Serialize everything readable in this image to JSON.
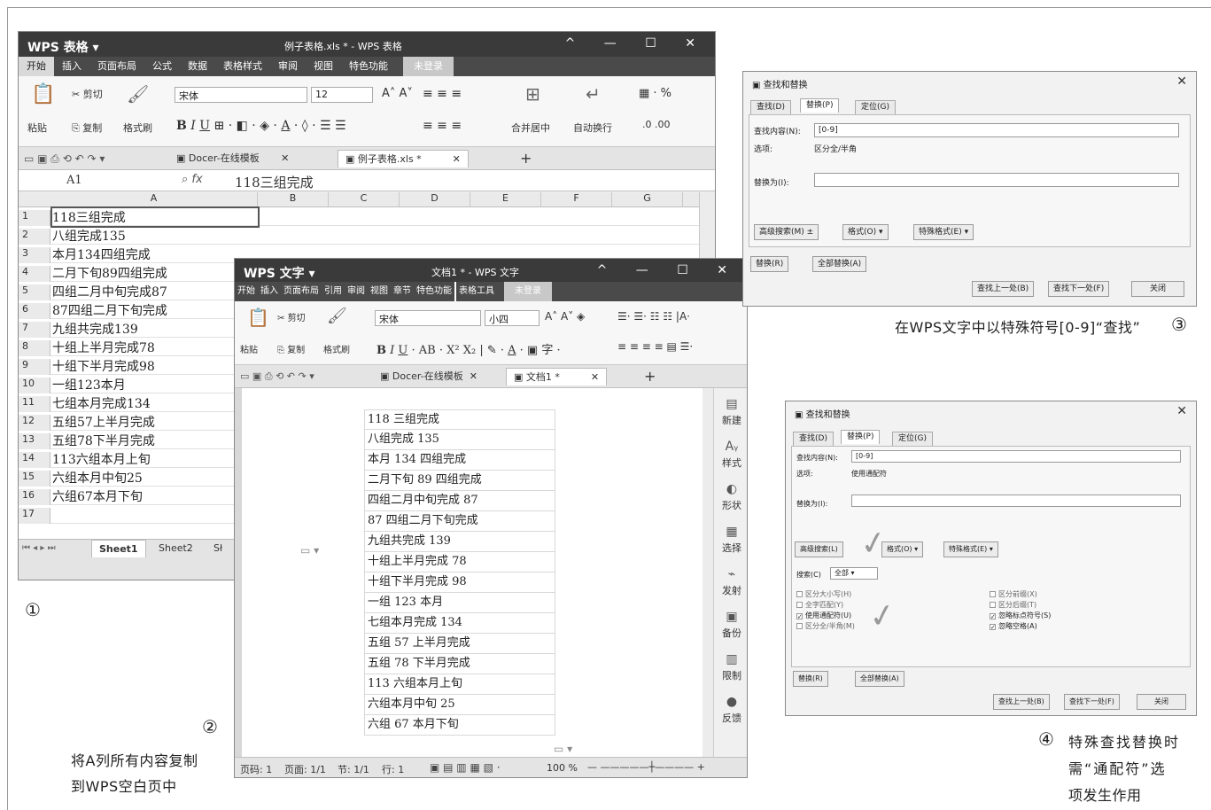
{
  "excel": {
    "app_name": "WPS 表格",
    "doc_title": "例子表格.xls * - WPS 表格",
    "menu": [
      "开始",
      "插入",
      "页面布局",
      "公式",
      "数据",
      "表格样式",
      "审阅",
      "视图",
      "特色功能"
    ],
    "login": "未登录",
    "ribbon": {
      "paste": "粘贴",
      "cut": "剪切",
      "copy": "复制",
      "format_painter": "格式刷",
      "font": "宋体",
      "font_size": "12",
      "merge_center": "合并居中",
      "wrap": "自动换行"
    },
    "tabs": [
      "Docer-在线模板",
      "例子表格.xls *"
    ],
    "cell_ref": "A1",
    "formula": "118三组完成",
    "columns": [
      "A",
      "B",
      "C",
      "D",
      "E",
      "F",
      "G"
    ],
    "rows": [
      {
        "n": "1",
        "v": "118三组完成"
      },
      {
        "n": "2",
        "v": "八组完成135"
      },
      {
        "n": "3",
        "v": "本月134四组完成"
      },
      {
        "n": "4",
        "v": "二月下旬89四组完成"
      },
      {
        "n": "5",
        "v": "四组二月中旬完成87"
      },
      {
        "n": "6",
        "v": "87四组二月下旬完成"
      },
      {
        "n": "7",
        "v": "九组共完成139"
      },
      {
        "n": "8",
        "v": "十组上半月完成78"
      },
      {
        "n": "9",
        "v": "十组下半月完成98"
      },
      {
        "n": "10",
        "v": "一组123本月"
      },
      {
        "n": "11",
        "v": "七组本月完成134"
      },
      {
        "n": "12",
        "v": "五组57上半月完成"
      },
      {
        "n": "13",
        "v": "五组78下半月完成"
      },
      {
        "n": "14",
        "v": "113六组本月上旬"
      },
      {
        "n": "15",
        "v": "六组本月中旬25"
      },
      {
        "n": "16",
        "v": "六组67本月下旬"
      },
      {
        "n": "17",
        "v": ""
      }
    ],
    "sheets": [
      "Sheet1",
      "Sheet2",
      "Sł"
    ]
  },
  "writer": {
    "app_name": "WPS 文字",
    "doc_title": "文档1 * - WPS 文字",
    "menu": [
      "开始",
      "插入",
      "页面布局",
      "引用",
      "审阅",
      "视图",
      "章节",
      "特色功能",
      "表格工具"
    ],
    "login": "未登录",
    "ribbon": {
      "paste": "粘贴",
      "cut": "剪切",
      "copy": "复制",
      "format_painter": "格式刷",
      "font": "宋体",
      "font_size": "小四"
    },
    "tabs": [
      "Docer-在线模板",
      "文档1 *"
    ],
    "lines": [
      "118 三组完成",
      "八组完成 135",
      "本月 134 四组完成",
      "二月下旬 89 四组完成",
      "四组二月中旬完成 87",
      "87 四组二月下旬完成",
      "九组共完成 139",
      "十组上半月完成 78",
      "十组下半月完成 98",
      "一组 123 本月",
      "七组本月完成 134",
      "五组 57 上半月完成",
      "五组 78 下半月完成",
      "113 六组本月上旬",
      "六组本月中旬 25",
      "六组 67 本月下旬"
    ],
    "side": [
      "新建",
      "样式",
      "形状",
      "选择",
      "发射",
      "备份",
      "限制",
      "反馈"
    ],
    "status": {
      "page": "页码: 1",
      "pages": "页面: 1/1",
      "section": "节: 1/1",
      "row": "行: 1",
      "zoom": "100 %"
    }
  },
  "dialog1": {
    "title": "查找和替换",
    "tabs": [
      "查找(D)",
      "替换(P)",
      "定位(G)"
    ],
    "find_label": "查找内容(N):",
    "find_value": "[0-9]",
    "options_label": "选项:",
    "options_value": "区分全/半角",
    "replace_label": "替换为(I):",
    "replace_value": "",
    "btn_advanced": "高级搜索(M) ±",
    "btn_format": "格式(O) ▾",
    "btn_special": "特殊格式(E) ▾",
    "btn_replace": "替换(R)",
    "btn_replace_all": "全部替换(A)",
    "btn_prev": "查找上一处(B)",
    "btn_next": "查找下一处(F)",
    "btn_close": "关闭"
  },
  "dialog2": {
    "title": "查找和替换",
    "tabs": [
      "查找(D)",
      "替换(P)",
      "定位(G)"
    ],
    "find_label": "查找内容(N):",
    "find_value": "[0-9]",
    "options_label": "选项:",
    "options_value": "使用通配符",
    "replace_label": "替换为(I):",
    "replace_value": "",
    "btn_advanced": "高级搜索(L)",
    "btn_format": "格式(O) ▾",
    "btn_special": "特殊格式(E) ▾",
    "search_label": "搜索(C)",
    "search_value": "全部",
    "checks_left": [
      "区分大小写(H)",
      "全字匹配(Y)",
      "使用通配符(U)",
      "区分全/半角(M)"
    ],
    "checks_right": [
      "区分前缀(X)",
      "区分后缀(T)",
      "忽略标点符号(S)",
      "忽略空格(A)"
    ],
    "btn_replace": "替换(R)",
    "btn_replace_all": "全部替换(A)",
    "btn_prev": "查找上一处(B)",
    "btn_next": "查找下一处(F)",
    "btn_close": "关闭"
  },
  "captions": {
    "c1_num": "①",
    "c2_num": "②",
    "c2_line1": "将A列所有内容复制",
    "c2_line2": "到WPS空白页中",
    "c3_text": "在WPS文字中以特殊符号[0-9]“查找”",
    "c3_num": "③",
    "c4_num": "④",
    "c4_line1": "特殊查找替换时",
    "c4_line2": "需“通配符”选",
    "c4_line3": "项发生作用"
  },
  "colors": {
    "title_bg": "#3a3a3a",
    "menu_bg": "#4a4a4a",
    "window_border": "#8a8a8a"
  }
}
